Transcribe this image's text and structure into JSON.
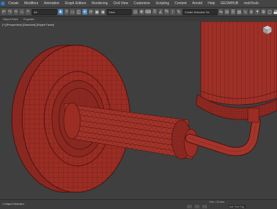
{
  "menu": {
    "items": [
      "Create",
      "Modifiers",
      "Animation",
      "Graph Editors",
      "Rendering",
      "Civil View",
      "Customize",
      "Scripting",
      "Content",
      "Arnold",
      "Help",
      "GEOMHUB",
      "mobTools"
    ]
  },
  "toolbar": {
    "selection_filter": "All",
    "view_label": "View",
    "named_selection": "Create Selection Se"
  },
  "ribbon": {
    "tabs": [
      "Object Paint",
      "Populate"
    ]
  },
  "viewport": {
    "label": "[+] [Perspective] [Standard] [Edged Faces]"
  },
  "status": {
    "selection": "1 Object Selected",
    "coords": "Grid = 10.0cm",
    "add_time_tag": "Add Time Tag"
  },
  "colors": {
    "model_red": "#9b2d24",
    "edge_dark": "#5a1612",
    "background": "#3f3f3f"
  }
}
